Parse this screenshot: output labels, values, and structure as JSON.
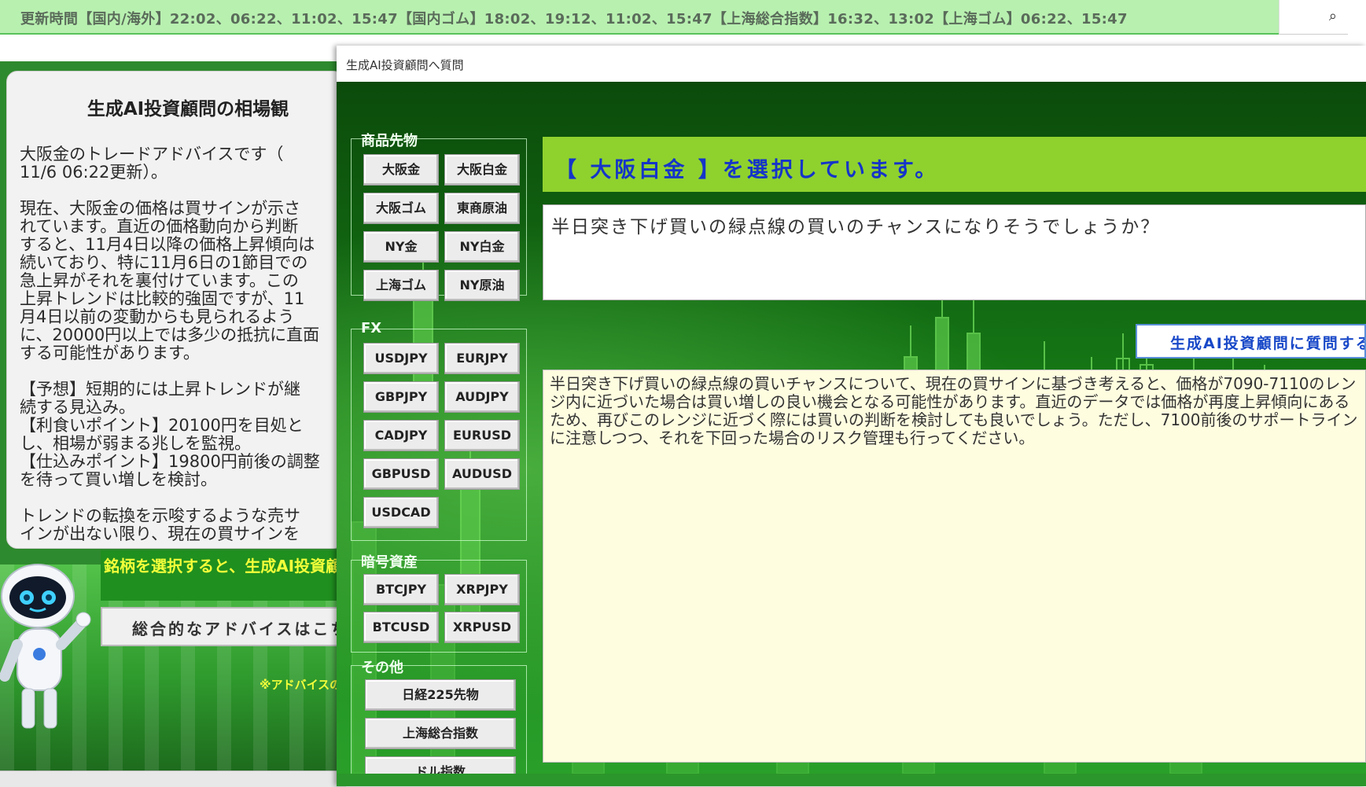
{
  "ticker": {
    "text": "更新時間【国内/海外】22:02、06:22、11:02、15:47【国内ゴム】18:02、19:12、11:02、15:47【上海総合指数】16:32、13:02【上海ゴム】06:22、15:47"
  },
  "search": {
    "icon": "search-icon"
  },
  "left_card": {
    "title": "生成AI投資顧問の相場観",
    "body": "大阪金のトレードアドバイスです（\n11/6 06:22更新）。\n\n現在、大阪金の価格は買サインが示さ\nれています。直近の価格動向から判断\nすると、11月4日以降の価格上昇傾向は\n続いており、特に11月6日の1節目での\n急上昇がそれを裏付けています。この\n上昇トレンドは比較的強固ですが、11\n月4日以前の変動からも見られるよう\nに、20000円以上では多少の抵抗に直面\nする可能性があります。\n\n【予想】短期的には上昇トレンドが継\n続する見込み。\n【利食いポイント】20100円を目処と\nし、相場が弱まる兆しを監視。\n【仕込みポイント】19800円前後の調整\nを待って買い増しを検討。\n\nトレンドの転換を示唆するような売サ\nインが出ない限り、現在の買サインを"
  },
  "left_lower": {
    "select_message": "銘柄を選択すると、生成AI投資顧問からのアドバイスが表示されます。",
    "overall_button": "総合的なアドバイスはこちら",
    "note": "※アドバイスの"
  },
  "dialog": {
    "title": "生成AI投資顧問へ質問",
    "groups": {
      "commodities": {
        "label": "商品先物",
        "buttons": [
          "大阪金",
          "大阪白金",
          "大阪ゴム",
          "東商原油",
          "NY金",
          "NY白金",
          "上海ゴム",
          "NY原油"
        ]
      },
      "fx": {
        "label": "FX",
        "buttons": [
          "USDJPY",
          "EURJPY",
          "GBPJPY",
          "AUDJPY",
          "CADJPY",
          "EURUSD",
          "GBPUSD",
          "AUDUSD",
          "USDCAD"
        ]
      },
      "crypto": {
        "label": "暗号資産",
        "buttons": [
          "BTCJPY",
          "XRPJPY",
          "BTCUSD",
          "XRPUSD"
        ]
      },
      "other": {
        "label": "その他",
        "buttons": [
          "日経225先物",
          "上海総合指数",
          "ドル指数"
        ]
      }
    },
    "selected_text": "【 大阪白金 】を選択しています。",
    "question": "半日突き下げ買いの緑点線の買いのチャンスになりそうでしょうか？",
    "ask_button": "生成AI投資顧問に質問する",
    "answer": "半日突き下げ買いの緑点線の買いチャンスについて、現在の買サインに基づき考えると、価格が7090-7110のレンジ内に近づいた場合は買い増しの良い機会となる可能性があります。直近のデータでは価格が再度上昇傾向にあるため、再びこのレンジに近づく際には買いの判断を検討しても良いでしょう。ただし、7100前後のサポートラインに注意しつつ、それを下回った場合のリスク管理も行ってください。"
  },
  "colors": {
    "ticker_bg": "#b8f0b0",
    "selected_bar": "#8fd22e",
    "selected_text": "#1535c8",
    "answer_bg": "#fffde0",
    "highlight_yellow": "#f3ff3a"
  }
}
